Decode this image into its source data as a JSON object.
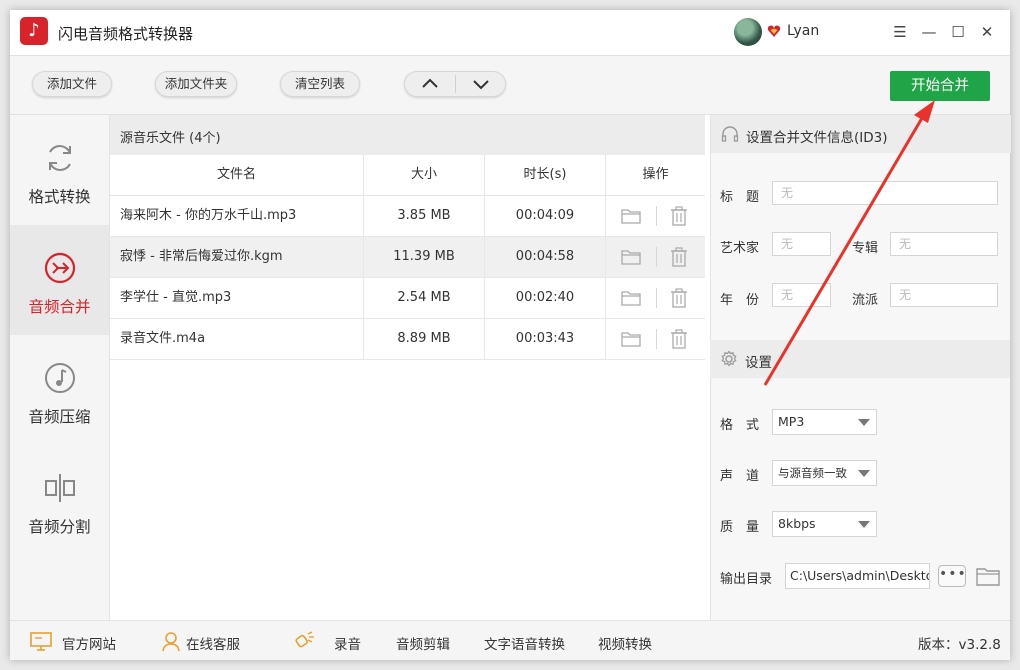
{
  "app": {
    "title": "闪电音频格式转换器",
    "logo_icon": "music-note-icon"
  },
  "user": {
    "name": "Lyan"
  },
  "window_controls": {
    "menu": "☰",
    "minimize": "—",
    "maximize": "☐",
    "close": "✕"
  },
  "toolbar": {
    "add_file": "添加文件",
    "add_folder": "添加文件夹",
    "clear_list": "清空列表",
    "start": "开始合并"
  },
  "sidebar": {
    "items": [
      {
        "label": "格式转换",
        "icon": "refresh-icon"
      },
      {
        "label": "音频合并",
        "icon": "merge-icon"
      },
      {
        "label": "音频压缩",
        "icon": "music-disc-icon"
      },
      {
        "label": "音频分割",
        "icon": "split-icon"
      }
    ]
  },
  "file_list": {
    "header": "源音乐文件 (4个)",
    "columns": {
      "name": "文件名",
      "size": "大小",
      "duration": "时长(s)",
      "ops": "操作"
    },
    "rows": [
      {
        "name": "海来阿木 - 你的万水千山.mp3",
        "size": "3.85 MB",
        "duration": "00:04:09"
      },
      {
        "name": "寂悸 - 非常后悔爱过你.kgm",
        "size": "11.39 MB",
        "duration": "00:04:58"
      },
      {
        "name": "李学仕 - 直觉.mp3",
        "size": "2.54 MB",
        "duration": "00:02:40"
      },
      {
        "name": "录音文件.m4a",
        "size": "8.89 MB",
        "duration": "00:03:43"
      }
    ]
  },
  "id3": {
    "heading": "设置合并文件信息(ID3)",
    "title_label": "标　题",
    "artist_label": "艺术家",
    "album_label": "专辑",
    "year_label": "年　份",
    "genre_label": "流派",
    "placeholder": "无"
  },
  "settings": {
    "heading": "设置",
    "format_label": "格　式",
    "format_value": "MP3",
    "channel_label": "声　道",
    "channel_value": "与源音频一致",
    "quality_label": "质　量",
    "quality_value": "8kbps",
    "output_label": "输出目录",
    "output_value": "C:\\Users\\admin\\Desktop",
    "more": "•••"
  },
  "footer": {
    "website": "官方网站",
    "support": "在线客服",
    "record": "录音",
    "audio_cut": "音频剪辑",
    "tts": "文字语音转换",
    "video": "视频转换",
    "version": "版本：v3.2.8"
  },
  "colors": {
    "accent_red": "#d9232b",
    "start_green": "#1fa447",
    "annotation_red": "#e8322b"
  }
}
